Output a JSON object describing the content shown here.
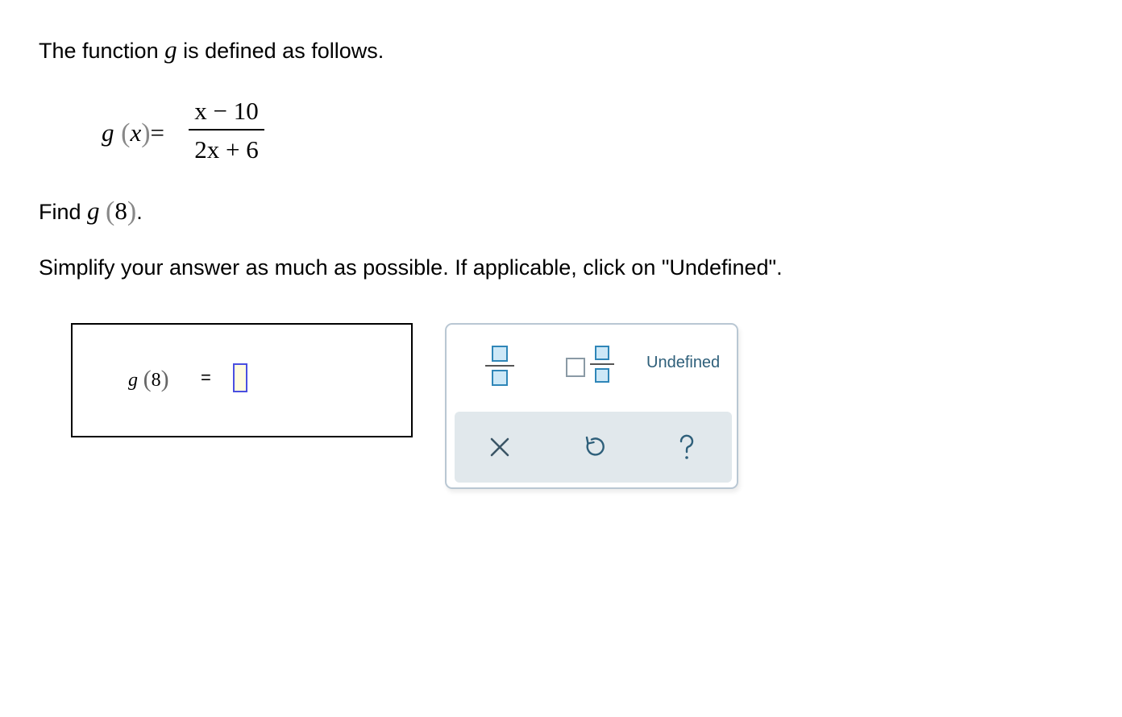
{
  "prompt": {
    "intro_before": "The function ",
    "intro_var": "g",
    "intro_after": " is defined as follows.",
    "find_label": "Find ",
    "find_func": "g",
    "find_open": "(",
    "find_arg": "8",
    "find_close": ")",
    "find_end": ".",
    "instruction": "Simplify your answer as much as possible. If applicable, click on \"Undefined\"."
  },
  "definition": {
    "func": "g",
    "open": "(",
    "var": "x",
    "close": ")",
    "equals": "=",
    "numerator": "x − 10",
    "denominator": "2x + 6"
  },
  "answer": {
    "func": "g",
    "open": "(",
    "arg": "8",
    "close": ")",
    "equals": "=",
    "value": ""
  },
  "palette": {
    "fraction_icon": "fraction-template-icon",
    "mixed_icon": "mixed-number-template-icon",
    "undefined_label": "Undefined",
    "clear_icon": "close-icon",
    "undo_icon": "undo-icon",
    "help_icon": "help-icon",
    "accent_color": "#2f86b8",
    "action_bar_color": "#e1e8ec"
  }
}
